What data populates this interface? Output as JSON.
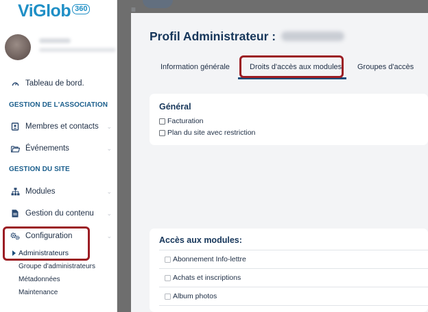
{
  "brand": {
    "name": "ViGlob",
    "badge": "360",
    "color": "#1f8fc6"
  },
  "sidebar": {
    "dashboard": {
      "label": "Tableau de bord.",
      "icon": "dashboard-gauge-icon"
    },
    "section_association": "GESTION DE L'ASSOCIATION",
    "members": {
      "label": "Membres et contacts",
      "icon": "contacts-icon"
    },
    "events": {
      "label": "Événements",
      "icon": "folder-icon"
    },
    "section_site": "GESTION DU SITE",
    "modules": {
      "label": "Modules",
      "icon": "sitemap-icon"
    },
    "content": {
      "label": "Gestion du contenu",
      "icon": "document-icon"
    },
    "configuration": {
      "label": "Configuration",
      "icon": "gears-icon"
    },
    "sub_items": {
      "administrators": "Administrateurs",
      "admin_groups": "Groupe d'administrateurs",
      "metadata": "Métadonnées",
      "maintenance": "Maintenance"
    }
  },
  "page": {
    "title": "Profil Administrateur :",
    "tabs": {
      "general": "Information générale",
      "module_rights": "Droits d'accès aux modules",
      "access_groups": "Groupes d'accès"
    }
  },
  "general_card": {
    "title": "Général",
    "options": [
      "Facturation",
      "Plan du site avec restriction"
    ]
  },
  "modules_card": {
    "title": "Accès aux modules:",
    "options": [
      "Abonnement Info-lettre",
      "Achats et inscriptions",
      "Album photos"
    ]
  },
  "colors": {
    "highlight": "#9b1c23",
    "accent": "#1a5e8c",
    "heading": "#16365a"
  }
}
